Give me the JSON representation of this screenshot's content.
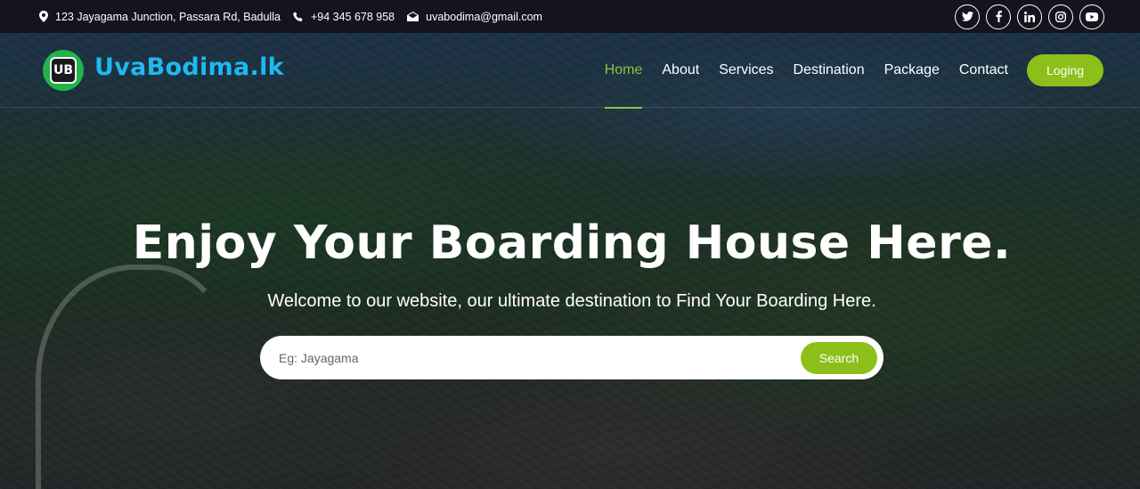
{
  "topbar": {
    "address": "123 Jayagama Junction, Passara Rd, Badulla",
    "phone": "+94 345 678 958",
    "email": "uvabodima@gmail.com",
    "socials": [
      "twitter-icon",
      "facebook-icon",
      "linkedin-icon",
      "instagram-icon",
      "youtube-icon"
    ]
  },
  "brand": {
    "logo_initials": "UB",
    "name": "UvaBodima.lk",
    "name_color": "#1fb8f0"
  },
  "nav": {
    "items": [
      {
        "label": "Home",
        "active": true
      },
      {
        "label": "About",
        "active": false
      },
      {
        "label": "Services",
        "active": false
      },
      {
        "label": "Destination",
        "active": false
      },
      {
        "label": "Package",
        "active": false
      },
      {
        "label": "Contact",
        "active": false
      }
    ],
    "login_label": "Loging"
  },
  "hero": {
    "title": "Enjoy Your Boarding House Here.",
    "subtitle": "Welcome to our website, our ultimate destination to Find Your Boarding Here."
  },
  "search": {
    "placeholder": "Eg: Jayagama",
    "value": "",
    "button_label": "Search"
  },
  "colors": {
    "accent": "#8dbf1a",
    "active_nav": "#8cc63f",
    "topbar_bg": "#14141f"
  }
}
